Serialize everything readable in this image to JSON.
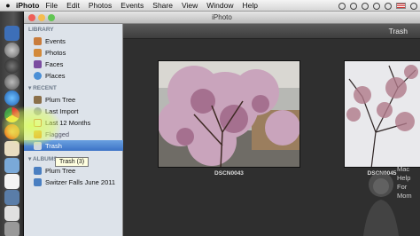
{
  "menubar": {
    "app_name": "iPhoto",
    "items": [
      "File",
      "Edit",
      "Photos",
      "Events",
      "Share",
      "View",
      "Window",
      "Help"
    ]
  },
  "window": {
    "title": "iPhoto"
  },
  "sidebar": {
    "library_header": "LIBRARY",
    "library_items": [
      {
        "label": "Events",
        "icon": "events-icon"
      },
      {
        "label": "Photos",
        "icon": "photos-icon"
      },
      {
        "label": "Faces",
        "icon": "faces-icon"
      },
      {
        "label": "Places",
        "icon": "places-icon"
      }
    ],
    "recent_header": "RECENT",
    "recent_items": [
      {
        "label": "Plum Tree",
        "icon": "event-icon"
      },
      {
        "label": "Last Import",
        "icon": "clock-icon"
      },
      {
        "label": "Last 12 Months",
        "icon": "calendar-icon"
      },
      {
        "label": "Flagged",
        "icon": "flag-icon"
      },
      {
        "label": "Trash",
        "icon": "trash-icon"
      }
    ],
    "albums_header": "ALBUMS",
    "album_items": [
      {
        "label": "Plum Tree",
        "icon": "album-icon"
      },
      {
        "label": "Switzer Falls June 2011",
        "icon": "album-icon"
      }
    ],
    "tooltip": "Trash (3)"
  },
  "main": {
    "header_title": "Trash",
    "photos": [
      {
        "caption": "DSCN0043"
      },
      {
        "caption": "DSCN0045"
      }
    ]
  },
  "watermark": {
    "lines": [
      "Mac",
      "Help",
      "For",
      "Mom"
    ]
  },
  "colors": {
    "selection": "#3c73c6",
    "sidebar": "#dde3ea",
    "main_bg": "#2f2f2f",
    "blossom": "#c9a4bc"
  }
}
